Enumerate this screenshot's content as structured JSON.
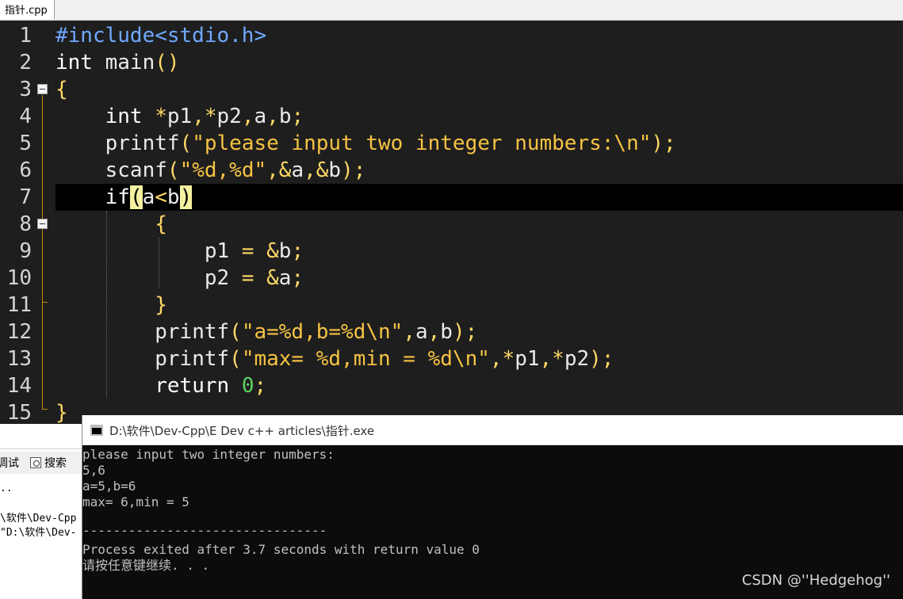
{
  "tab": {
    "label": "指针.cpp"
  },
  "editor": {
    "line_numbers": [
      "1",
      "2",
      "3",
      "4",
      "5",
      "6",
      "7",
      "8",
      "9",
      "10",
      "11",
      "12",
      "13",
      "14",
      "15"
    ]
  },
  "code": {
    "l1": {
      "directive": "#include<stdio.h>"
    },
    "l2": {
      "type": "int",
      "name": " main",
      "parens": "()"
    },
    "l3": {
      "brace": "{"
    },
    "l4": {
      "indent": "    ",
      "type": "int",
      "rest_op1": " *",
      "v1": "p1",
      "c1": ",",
      "op2": "*",
      "v2": "p2",
      "c2": ",",
      "v3": "a",
      "c3": ",",
      "v4": "b",
      "semi": ";"
    },
    "l5": {
      "indent": "    ",
      "fn": "printf",
      "open": "(",
      "str": "\"please input two integer numbers:\\n\"",
      "close": ");"
    },
    "l6": {
      "indent": "    ",
      "fn": "scanf",
      "open": "(",
      "str": "\"%d,%d\"",
      "c1": ",",
      "amp1": "&",
      "v1": "a",
      "c2": ",",
      "amp2": "&",
      "v2": "b",
      "close": ");"
    },
    "l7": {
      "indent": "    ",
      "kw": "if",
      "open": "(",
      "v1": "a",
      "op": "<",
      "v2": "b",
      "close": ")"
    },
    "l8": {
      "indent": "        ",
      "brace": "{"
    },
    "l9": {
      "indent": "            ",
      "v1": "p1",
      "op": " = &",
      "v2": "b",
      "semi": ";"
    },
    "l10": {
      "indent": "            ",
      "v1": "p2",
      "op": " = &",
      "v2": "a",
      "semi": ";"
    },
    "l11": {
      "indent": "        ",
      "brace": "}"
    },
    "l12": {
      "indent": "        ",
      "fn": "printf",
      "open": "(",
      "str": "\"a=%d,b=%d\\n\"",
      "c1": ",",
      "v1": "a",
      "c2": ",",
      "v2": "b",
      "close": ");"
    },
    "l13": {
      "indent": "        ",
      "fn": "printf",
      "open": "(",
      "str": "\"max= %d,min = %d\\n\"",
      "c1": ",*",
      "v1": "p1",
      "c2": ",*",
      "v2": "p2",
      "close": ");"
    },
    "l14": {
      "indent": "        ",
      "kw": "return",
      "sp": " ",
      "num": "0",
      "semi": ";"
    },
    "l15": {
      "brace": "}"
    }
  },
  "bottom_panel": {
    "tab1": "调试",
    "tab2": "搜索",
    "log": [
      "..",
      "\\软件\\Dev-Cpp",
      "\"D:\\软件\\Dev-"
    ]
  },
  "console": {
    "title": "D:\\软件\\Dev-Cpp\\E   Dev c++ articles\\指针.exe",
    "lines": [
      "please input two integer numbers:",
      "5,6",
      "a=5,b=6",
      "max= 6,min = 5",
      "",
      "--------------------------------",
      "Process exited after 3.7 seconds with return value 0",
      "请按任意键继续. . ."
    ]
  },
  "watermark": "CSDN @''Hedgehog''",
  "icons": {
    "fold": "fold-minus-icon",
    "console": "console-window-icon",
    "search": "search-icon"
  }
}
